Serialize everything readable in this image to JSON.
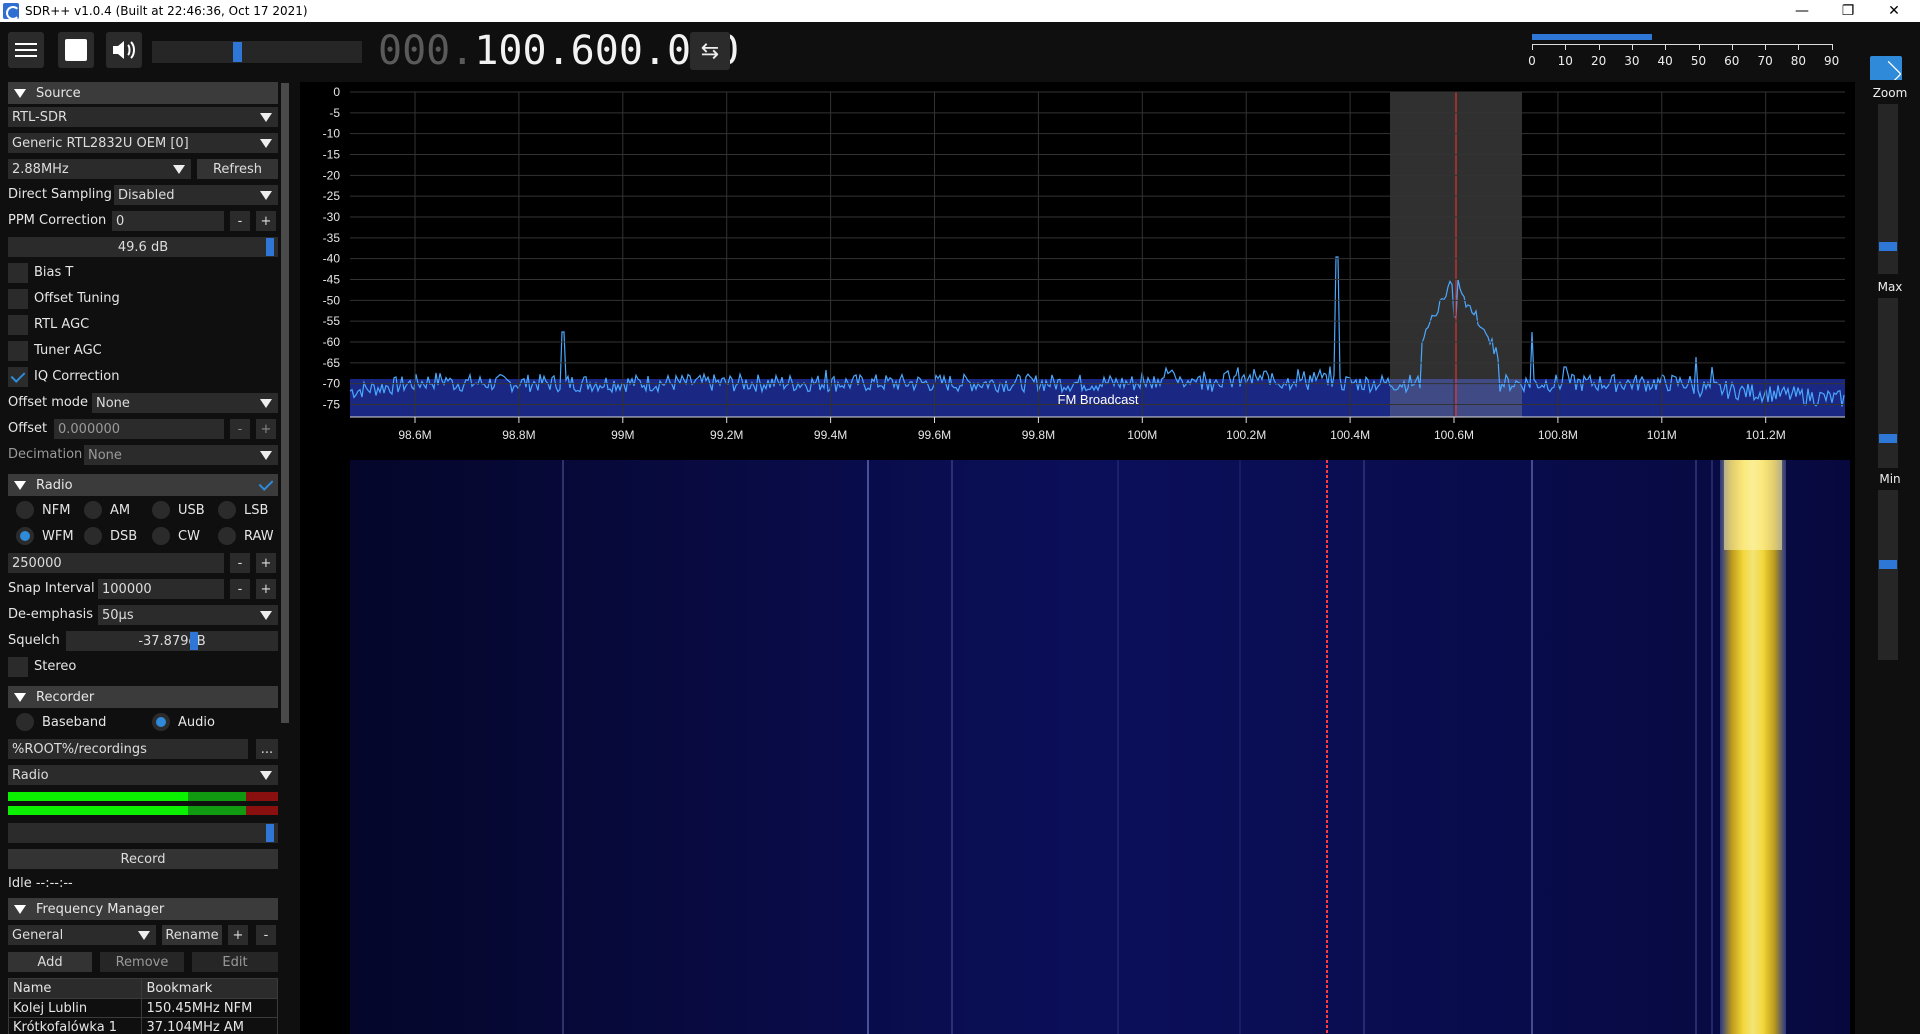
{
  "window": {
    "title": "SDR++ v1.0.4 (Built at 22:46:36, Oct 17 2021)",
    "controls": [
      "—",
      "❐",
      "✕"
    ]
  },
  "toolbar": {
    "freq_dim": "000.",
    "freq_bright": "100.600.000",
    "snr_scale": [
      "0",
      "10",
      "20",
      "30",
      "40",
      "50",
      "60",
      "70",
      "80",
      "90"
    ]
  },
  "source": {
    "header": "Source",
    "device_type": "RTL-SDR",
    "device": "Generic RTL2832U OEM [0]",
    "sample_rate": "2.88MHz",
    "refresh": "Refresh",
    "direct_sampling_label": "Direct Sampling",
    "direct_sampling_value": "Disabled",
    "ppm_label": "PPM Correction",
    "ppm_value": "0",
    "gain": "49.6 dB",
    "bias_t": "Bias T",
    "offset_tuning": "Offset Tuning",
    "rtl_agc": "RTL AGC",
    "tuner_agc": "Tuner AGC",
    "iq_correction": "IQ Correction",
    "offset_mode_label": "Offset mode",
    "offset_mode_value": "None",
    "offset_label": "Offset",
    "offset_value": "0.000000",
    "decimation_label": "Decimation",
    "decimation_value": "None",
    "minus": "-",
    "plus": "+"
  },
  "radio": {
    "header": "Radio",
    "modes": [
      "NFM",
      "AM",
      "USB",
      "LSB",
      "WFM",
      "DSB",
      "CW",
      "RAW"
    ],
    "selected_mode": "WFM",
    "bandwidth": "250000",
    "snap_label": "Snap Interval",
    "snap_value": "100000",
    "deemph_label": "De-emphasis",
    "deemph_value": "50µs",
    "squelch_label": "Squelch",
    "squelch_value": "-37.879dB",
    "stereo": "Stereo"
  },
  "recorder": {
    "header": "Recorder",
    "baseband": "Baseband",
    "audio": "Audio",
    "path": "%ROOT%/recordings",
    "browse": "...",
    "stream": "Radio",
    "record": "Record",
    "status": "Idle --:--:--"
  },
  "freq_manager": {
    "header": "Frequency Manager",
    "list": "General",
    "rename": "Rename",
    "add_list": "+",
    "remove_list": "-",
    "add": "Add",
    "remove": "Remove",
    "edit": "Edit",
    "columns": [
      "Name",
      "Bookmark"
    ],
    "rows": [
      [
        "Kolej Lublin",
        "150.45MHz NFM"
      ],
      [
        "Krótkofalówka 1",
        "37.104MHz AM"
      ]
    ]
  },
  "fft": {
    "y_ticks": [
      "0",
      "-5",
      "-10",
      "-15",
      "-20",
      "-25",
      "-30",
      "-35",
      "-40",
      "-45",
      "-50",
      "-55",
      "-60",
      "-65",
      "-70",
      "-75"
    ],
    "x_ticks": [
      "98.6M",
      "98.8M",
      "99M",
      "99.2M",
      "99.4M",
      "99.6M",
      "99.8M",
      "100M",
      "100.2M",
      "100.4M",
      "100.6M",
      "100.8M",
      "101M",
      "101.2M"
    ],
    "band_label": "FM Broadcast"
  },
  "right": {
    "zoom": "Zoom",
    "max": "Max",
    "min": "Min"
  },
  "colors": {
    "accent": "#2f77d6",
    "trace": "#4aa8ff",
    "band": "#1e2f9a"
  }
}
